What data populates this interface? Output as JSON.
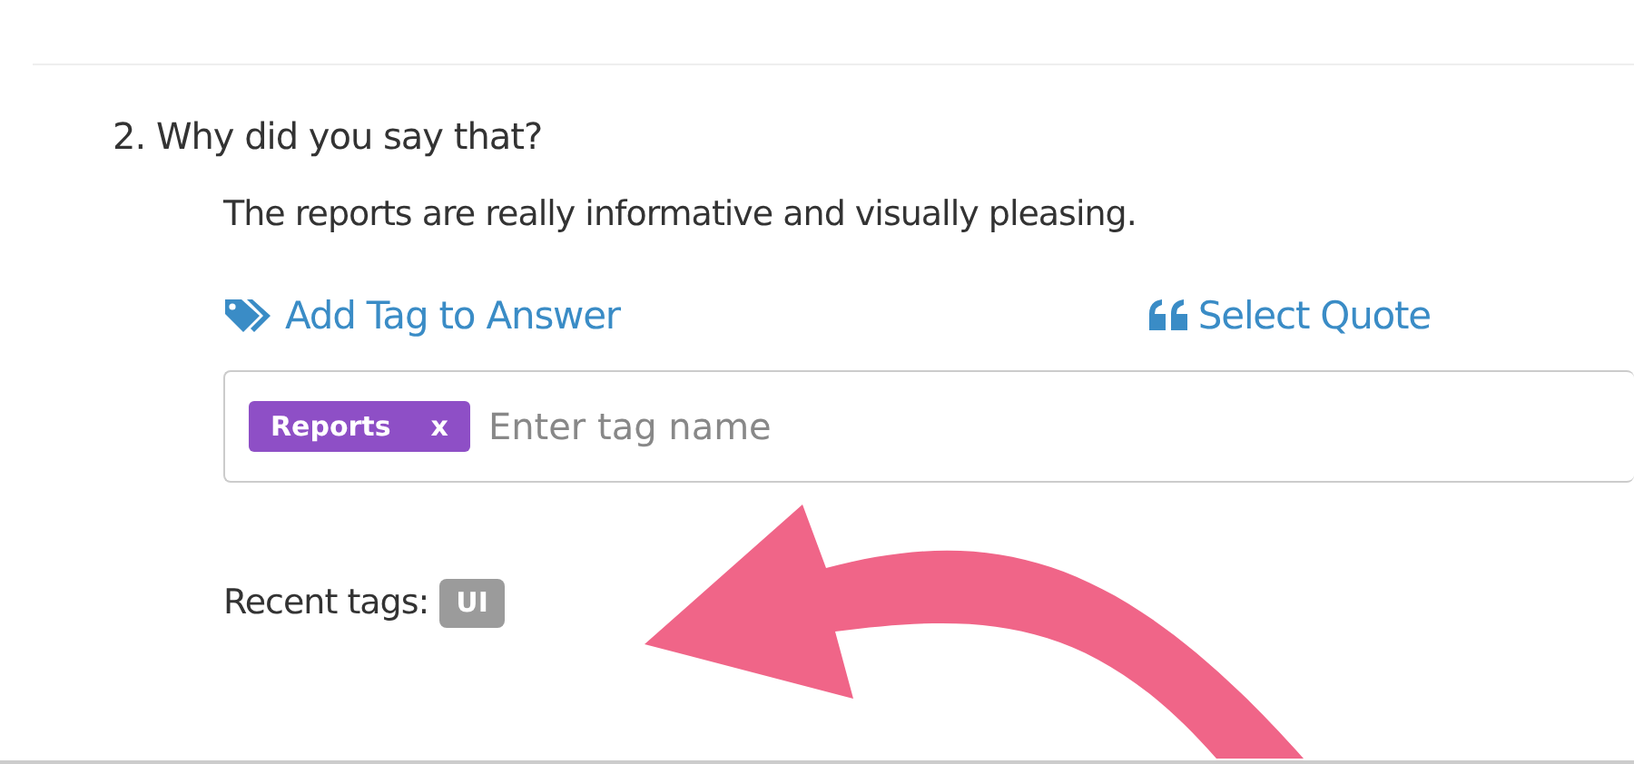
{
  "question": "2. Why did you say that?",
  "answer": "The reports are really informative and visually pleasing.",
  "actions": [
    {
      "kind": "tag",
      "label": "Add Tag to Answer"
    },
    {
      "kind": "quote",
      "label": "Select Quote"
    }
  ],
  "tag_field": {
    "tags": [
      {
        "label": "Reports",
        "remove": "x",
        "color": "#8e4fc6"
      }
    ],
    "placeholder": "Enter tag name"
  },
  "recent_tags": {
    "label": "Recent tags:",
    "tags": [
      {
        "label": "UI",
        "color": "#9b9b9b"
      }
    ]
  }
}
